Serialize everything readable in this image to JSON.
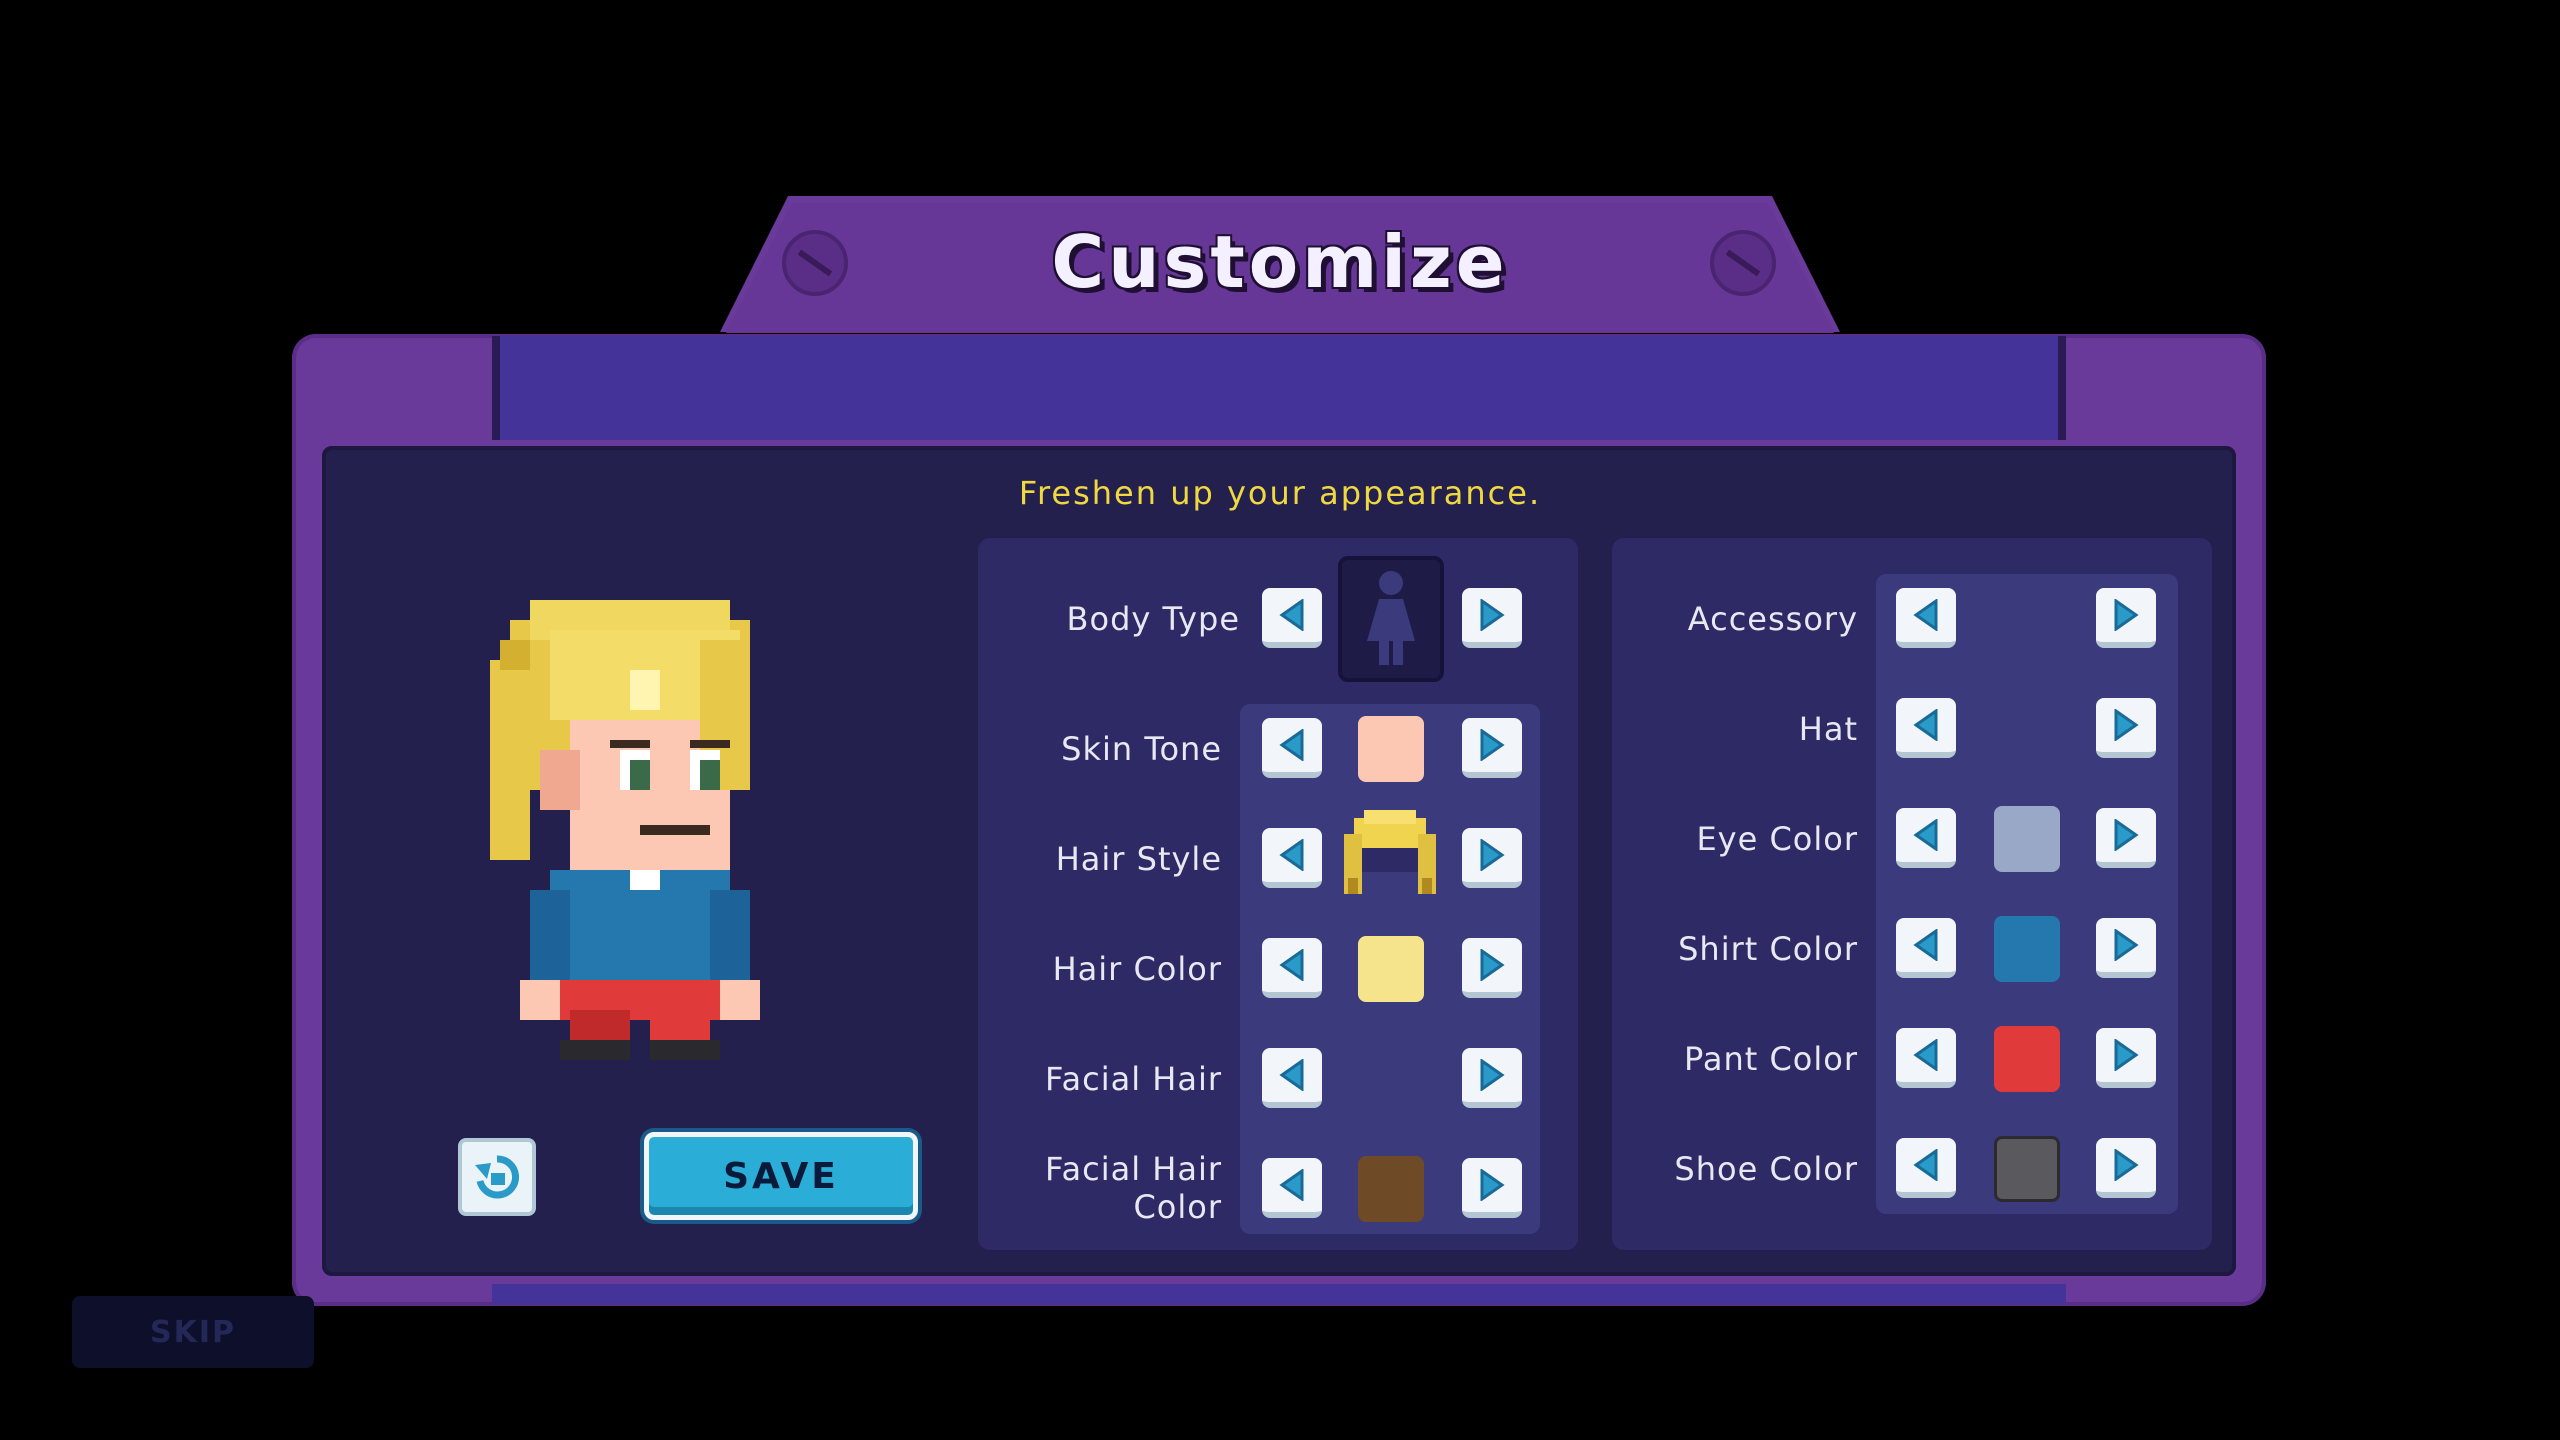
{
  "title": "Customize",
  "subtitle": "Freshen up your appearance.",
  "save_label": "SAVE",
  "skip_label": "SKIP",
  "left_options": {
    "body_type": "Body Type",
    "skin_tone": "Skin Tone",
    "hair_style": "Hair Style",
    "hair_color": "Hair Color",
    "facial_hair": "Facial Hair",
    "facial_hair_color_1": "Facial Hair",
    "facial_hair_color_2": "Color"
  },
  "right_options": {
    "accessory": "Accessory",
    "hat": "Hat",
    "eye_color": "Eye Color",
    "shirt_color": "Shirt Color",
    "pant_color": "Pant Color",
    "shoe_color": "Shoe Color"
  },
  "colors": {
    "skin_tone": "#fcc8b4",
    "hair_color": "#f6e48c",
    "facial_hair_color": "#6e4a26",
    "eye_color": "#98a8c6",
    "shirt_color": "#2478ae",
    "pant_color": "#e03a3a",
    "shoe_color": "#5a5a5e",
    "accent": "#2aaed8"
  }
}
